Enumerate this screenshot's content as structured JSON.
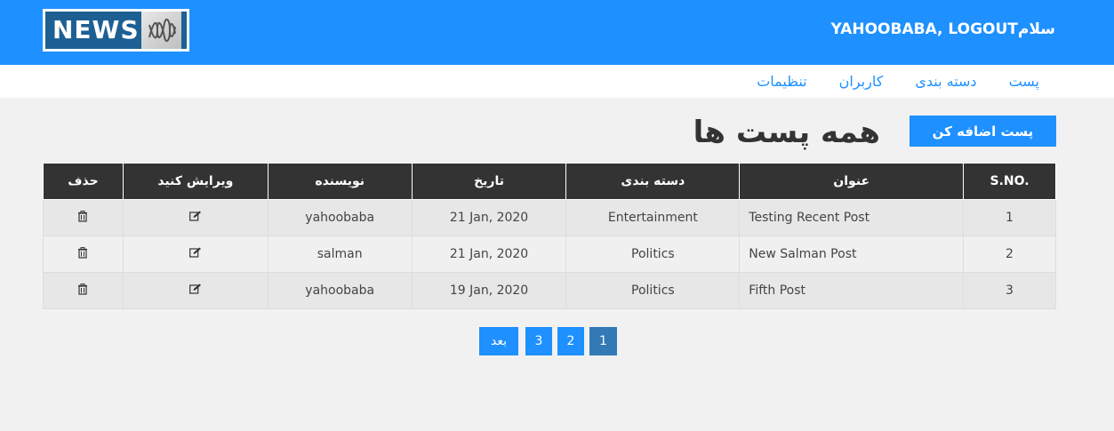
{
  "header": {
    "logo_text": "NEWS",
    "user_link": "YAHOOBABA, LOGOUTسلام"
  },
  "menu": [
    {
      "label": "پست"
    },
    {
      "label": "دسته بندی"
    },
    {
      "label": "کاربران"
    },
    {
      "label": "تنظیمات"
    }
  ],
  "page": {
    "title": "همه پست ها",
    "add_button": "پست اضافه کن"
  },
  "table": {
    "headers": {
      "sno": "S.NO.",
      "title": "عنوان",
      "category": "دسته بندی",
      "date": "تاریخ",
      "author": "نویسنده",
      "edit": "ویرایش کنید",
      "delete": "حذف"
    },
    "rows": [
      {
        "sno": "1",
        "title": "Testing Recent Post",
        "category": "Entertainment",
        "date": "21 Jan, 2020",
        "author": "yahoobaba"
      },
      {
        "sno": "2",
        "title": "New Salman Post",
        "category": "Politics",
        "date": "21 Jan, 2020",
        "author": "salman"
      },
      {
        "sno": "3",
        "title": "Fifth Post",
        "category": "Politics",
        "date": "19 Jan, 2020",
        "author": "yahoobaba"
      }
    ]
  },
  "pagination": {
    "next_label": "بعد",
    "pages": [
      "3",
      "2",
      "1"
    ],
    "active_page": "1"
  },
  "colors": {
    "primary": "#1e90ff",
    "active_page": "#337ab7",
    "table_header": "#333333",
    "background": "#f1f1f1"
  },
  "icons": {
    "edit": "edit-icon",
    "delete": "trash-icon"
  }
}
